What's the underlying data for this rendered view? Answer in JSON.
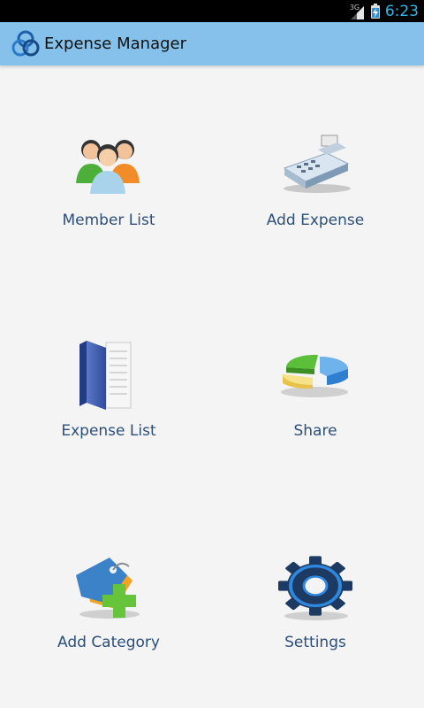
{
  "status_bar": {
    "network_label": "3G",
    "time": "6:23",
    "icons": [
      "signal-icon",
      "battery-charging-icon"
    ]
  },
  "action_bar": {
    "title": "Expense Manager",
    "icon": "app-logo-icon"
  },
  "menu": [
    {
      "label": "Member List",
      "icon": "members-icon"
    },
    {
      "label": "Add Expense",
      "icon": "cash-register-icon"
    },
    {
      "label": "Expense List",
      "icon": "binder-icon"
    },
    {
      "label": "Share",
      "icon": "pie-chart-icon"
    },
    {
      "label": "Add Category",
      "icon": "add-tag-icon"
    },
    {
      "label": "Settings",
      "icon": "gear-icon"
    }
  ],
  "colors": {
    "status_bar_bg": "#000000",
    "clock": "#33b5e5",
    "action_bar_bg": "#85c1ea",
    "background": "#f4f4f4",
    "label_text": "#2b4f7a"
  }
}
